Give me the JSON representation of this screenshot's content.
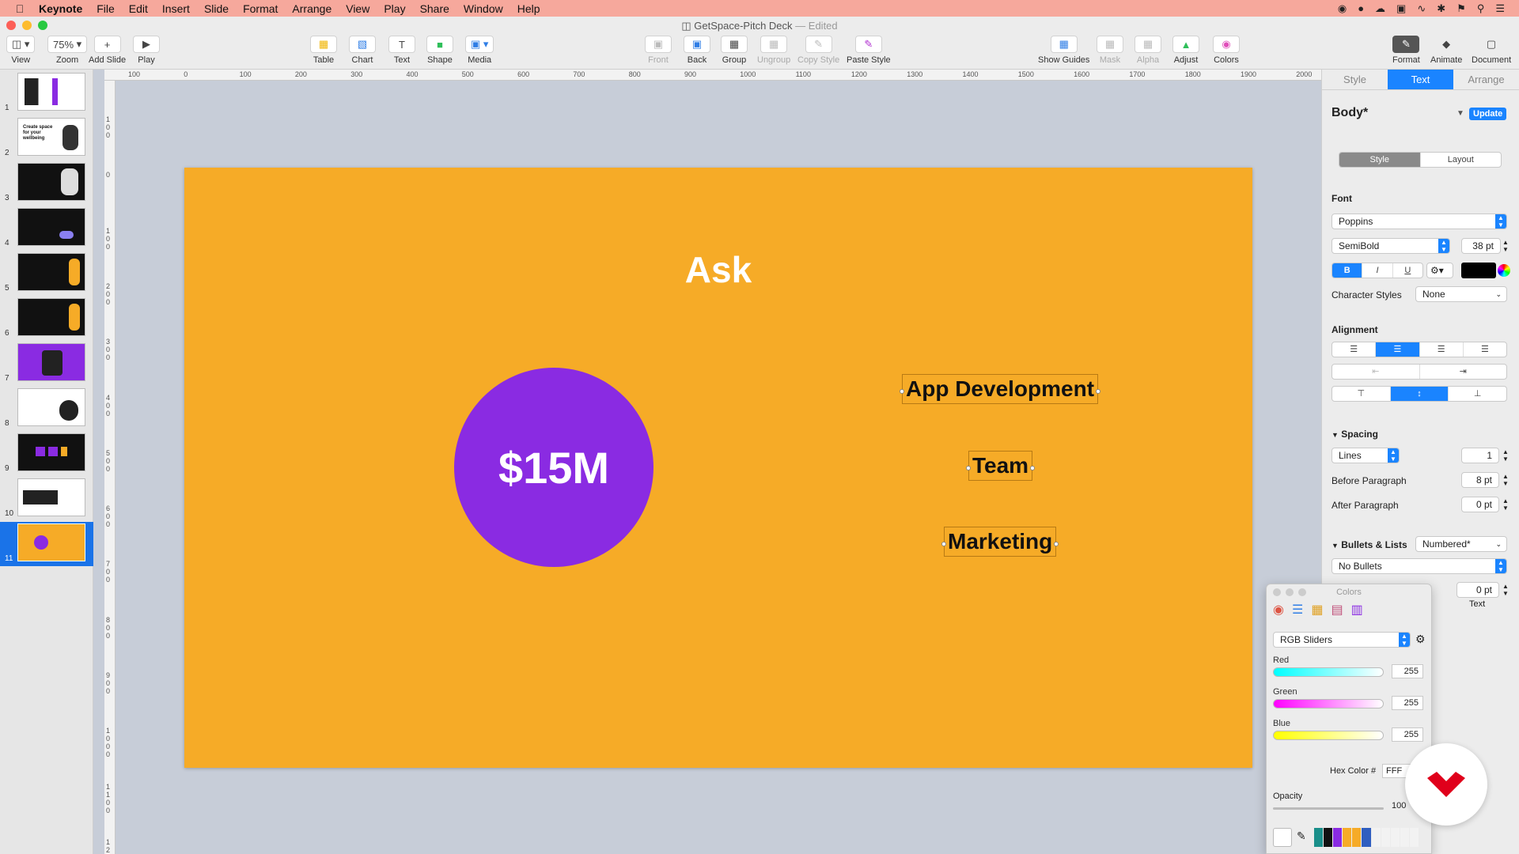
{
  "menubar": {
    "app": "Keynote",
    "items": [
      "File",
      "Edit",
      "Insert",
      "Slide",
      "Format",
      "Arrange",
      "View",
      "Play",
      "Share",
      "Window",
      "Help"
    ]
  },
  "window": {
    "title": "GetSpace-Pitch Deck",
    "status": "— Edited"
  },
  "toolbar": {
    "view": "View",
    "zoom": "Zoom",
    "zoom_value": "75%",
    "add_slide": "Add Slide",
    "play": "Play",
    "table": "Table",
    "chart": "Chart",
    "text": "Text",
    "shape": "Shape",
    "media": "Media",
    "front": "Front",
    "back": "Back",
    "group": "Group",
    "ungroup": "Ungroup",
    "copy_style": "Copy Style",
    "paste_style": "Paste Style",
    "show_guides": "Show Guides",
    "mask": "Mask",
    "alpha": "Alpha",
    "adjust": "Adjust",
    "colors": "Colors",
    "format": "Format",
    "animate": "Animate",
    "document": "Document"
  },
  "slides": {
    "numbers": [
      "1",
      "2",
      "3",
      "4",
      "5",
      "6",
      "7",
      "8",
      "9",
      "10",
      "11"
    ],
    "thumb2_text": "Create space for your wellbeing",
    "selected_index": 11
  },
  "ruler": {
    "h": [
      "100",
      "0",
      "100",
      "200",
      "300",
      "400",
      "500",
      "600",
      "700",
      "800",
      "900",
      "1000",
      "1100",
      "1200",
      "1300",
      "1400",
      "1500",
      "1600",
      "1700",
      "1800",
      "1900",
      "2000"
    ],
    "v": [
      "100",
      "0",
      "100",
      "200",
      "300",
      "400",
      "500",
      "600",
      "700",
      "800",
      "900",
      "1000",
      "1100",
      "12"
    ]
  },
  "slide": {
    "heading": "Ask",
    "amount": "$15M",
    "items": [
      "App Development",
      "Team",
      "Marketing"
    ]
  },
  "inspector": {
    "tabs": [
      "Style",
      "Text",
      "Arrange"
    ],
    "paragraph_style": "Body*",
    "update": "Update",
    "subtabs": [
      "Style",
      "Layout"
    ],
    "font_label": "Font",
    "font_family": "Poppins",
    "font_weight": "SemiBold",
    "font_size": "38 pt",
    "bold": "B",
    "italic": "I",
    "underline": "U",
    "char_styles_label": "Character Styles",
    "char_styles_value": "None",
    "alignment_label": "Alignment",
    "spacing_label": "Spacing",
    "spacing_mode": "Lines",
    "spacing_value": "1",
    "before_label": "Before Paragraph",
    "before_value": "8 pt",
    "after_label": "After Paragraph",
    "after_value": "0 pt",
    "bullets_label": "Bullets & Lists",
    "bullets_value": "Numbered*",
    "bullets_style": "No Bullets",
    "indent_value": "0 pt",
    "indent_label": "Text"
  },
  "colors_panel": {
    "title": "Colors",
    "mode": "RGB Sliders",
    "red_label": "Red",
    "red": "255",
    "green_label": "Green",
    "green": "255",
    "blue_label": "Blue",
    "blue": "255",
    "hex_label": "Hex Color #",
    "hex": "FFF",
    "opacity_label": "Opacity",
    "opacity": "100"
  },
  "theme": {
    "slide_bg": "#f6ab27",
    "circle": "#8a2be2",
    "accent": "#1a84ff",
    "menubar": "#f6a89c"
  }
}
